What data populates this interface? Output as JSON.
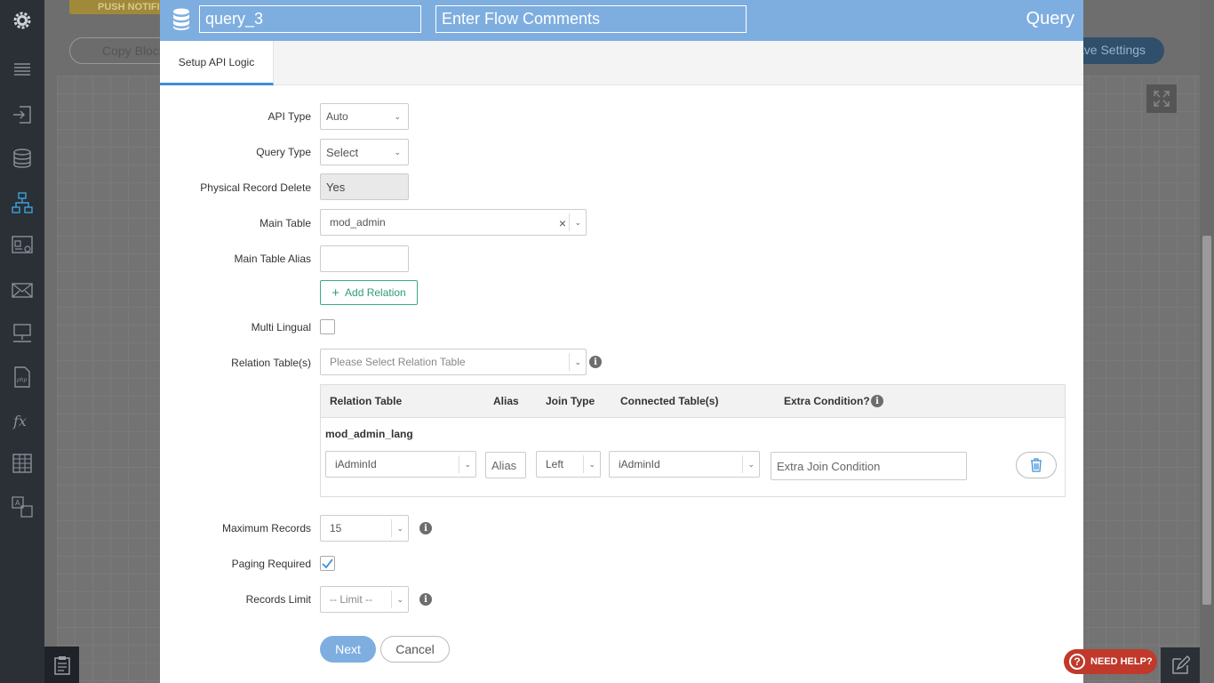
{
  "background": {
    "push_label": "PUSH NOTIFI",
    "copy_label": "Copy Block",
    "save_label": "ave Settings"
  },
  "sidebar": {
    "items": [
      "settings-icon",
      "menu-icon",
      "login-icon",
      "database-icon",
      "flow-icon",
      "screen-settings-icon",
      "mail-icon",
      "desktop-network-icon",
      "php-file-icon",
      "function-icon",
      "table-icon",
      "translate-icon"
    ]
  },
  "modal": {
    "header": {
      "name_value": "query_3",
      "comments_placeholder": "Enter Flow Comments",
      "title": "Query"
    },
    "tab": "Setup API Logic",
    "fields": {
      "api_type": {
        "label": "API Type",
        "value": "Auto"
      },
      "query_type": {
        "label": "Query Type",
        "value": "Select"
      },
      "physical_delete": {
        "label": "Physical Record Delete",
        "value": "Yes"
      },
      "main_table": {
        "label": "Main Table",
        "value": "mod_admin",
        "clear": "×"
      },
      "main_table_alias": {
        "label": "Main Table Alias",
        "value": ""
      },
      "add_relation": "Add Relation",
      "multi_lingual": {
        "label": "Multi Lingual",
        "checked": false
      },
      "relation_tables": {
        "label": "Relation Table(s)",
        "placeholder": "Please Select Relation Table"
      },
      "maximum_records": {
        "label": "Maximum Records",
        "value": "15"
      },
      "paging_required": {
        "label": "Paging Required",
        "checked": true
      },
      "records_limit": {
        "label": "Records Limit",
        "value": "-- Limit --"
      }
    },
    "relation_table": {
      "headers": [
        "Relation Table",
        "Alias",
        "Join Type",
        "Connected Table(s)",
        "Extra Condition?"
      ],
      "row": {
        "name": "mod_admin_lang",
        "field": "iAdminId",
        "alias_placeholder": "Alias",
        "join_type": "Left",
        "connected": "iAdminId",
        "extra_placeholder": "Extra Join Condition"
      }
    },
    "buttons": {
      "next": "Next",
      "cancel": "Cancel"
    }
  },
  "help": {
    "label": "NEED HELP?"
  },
  "colors": {
    "header": "#7eaee0",
    "accent": "#3aa987",
    "tab_underline": "#3a8fd9",
    "help": "#c0392b"
  }
}
